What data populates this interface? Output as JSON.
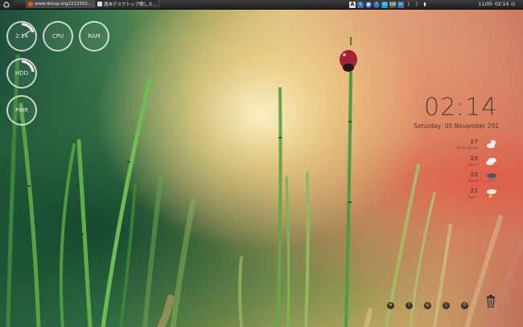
{
  "top_panel": {
    "tasks": [
      {
        "label": "www.dotup.org2222502...",
        "icon": "firefox-icon",
        "color": "#e66000"
      },
      {
        "label": "週末デスクトップ晒しス...",
        "icon": "document-icon",
        "color": "#dddddd"
      }
    ],
    "tray_icons": [
      "input-method-icon",
      "network-icon",
      "chat-icon",
      "help-icon",
      "messenger-icon",
      "keyboard-icon",
      "mail-icon",
      "bluetooth-icon",
      "volume-icon",
      "battery-icon",
      "power-icon"
    ],
    "input_method_label": "A",
    "date": "11/05",
    "time": "02:14"
  },
  "conky_rings": {
    "time": {
      "label": "2:14",
      "value": 0.3
    },
    "cpu": {
      "label": "CPU",
      "value": 0.05
    },
    "ram": {
      "label": "RAM",
      "value": 0.05
    },
    "hdd": {
      "label": "HDD",
      "value": 0.2
    },
    "fuel": {
      "label": "PWR",
      "value": 0.05
    },
    "ring_color": "#ffffff"
  },
  "clock": {
    "time": "02:14",
    "date": "Saturday, 05 November 201"
  },
  "weather": [
    {
      "temp": "17",
      "label": "Partly Cloudy",
      "icon": "partly-cloudy-icon"
    },
    {
      "temp": "23",
      "label": "Nov 5",
      "icon": "cloudy-icon"
    },
    {
      "temp": "22",
      "label": "Nov 6",
      "icon": "rain-icon"
    },
    {
      "temp": "21",
      "label": "Nov 7",
      "icon": "thunderstorm-icon"
    }
  ],
  "dock": {
    "buttons": [
      {
        "name": "dock-settings",
        "glyph": "✲"
      },
      {
        "name": "dock-help",
        "glyph": "?"
      },
      {
        "name": "dock-browser",
        "glyph": "◎"
      },
      {
        "name": "dock-app",
        "glyph": "▯"
      },
      {
        "name": "dock-power",
        "glyph": "⏻"
      }
    ],
    "trash_icon": "trash-icon"
  }
}
